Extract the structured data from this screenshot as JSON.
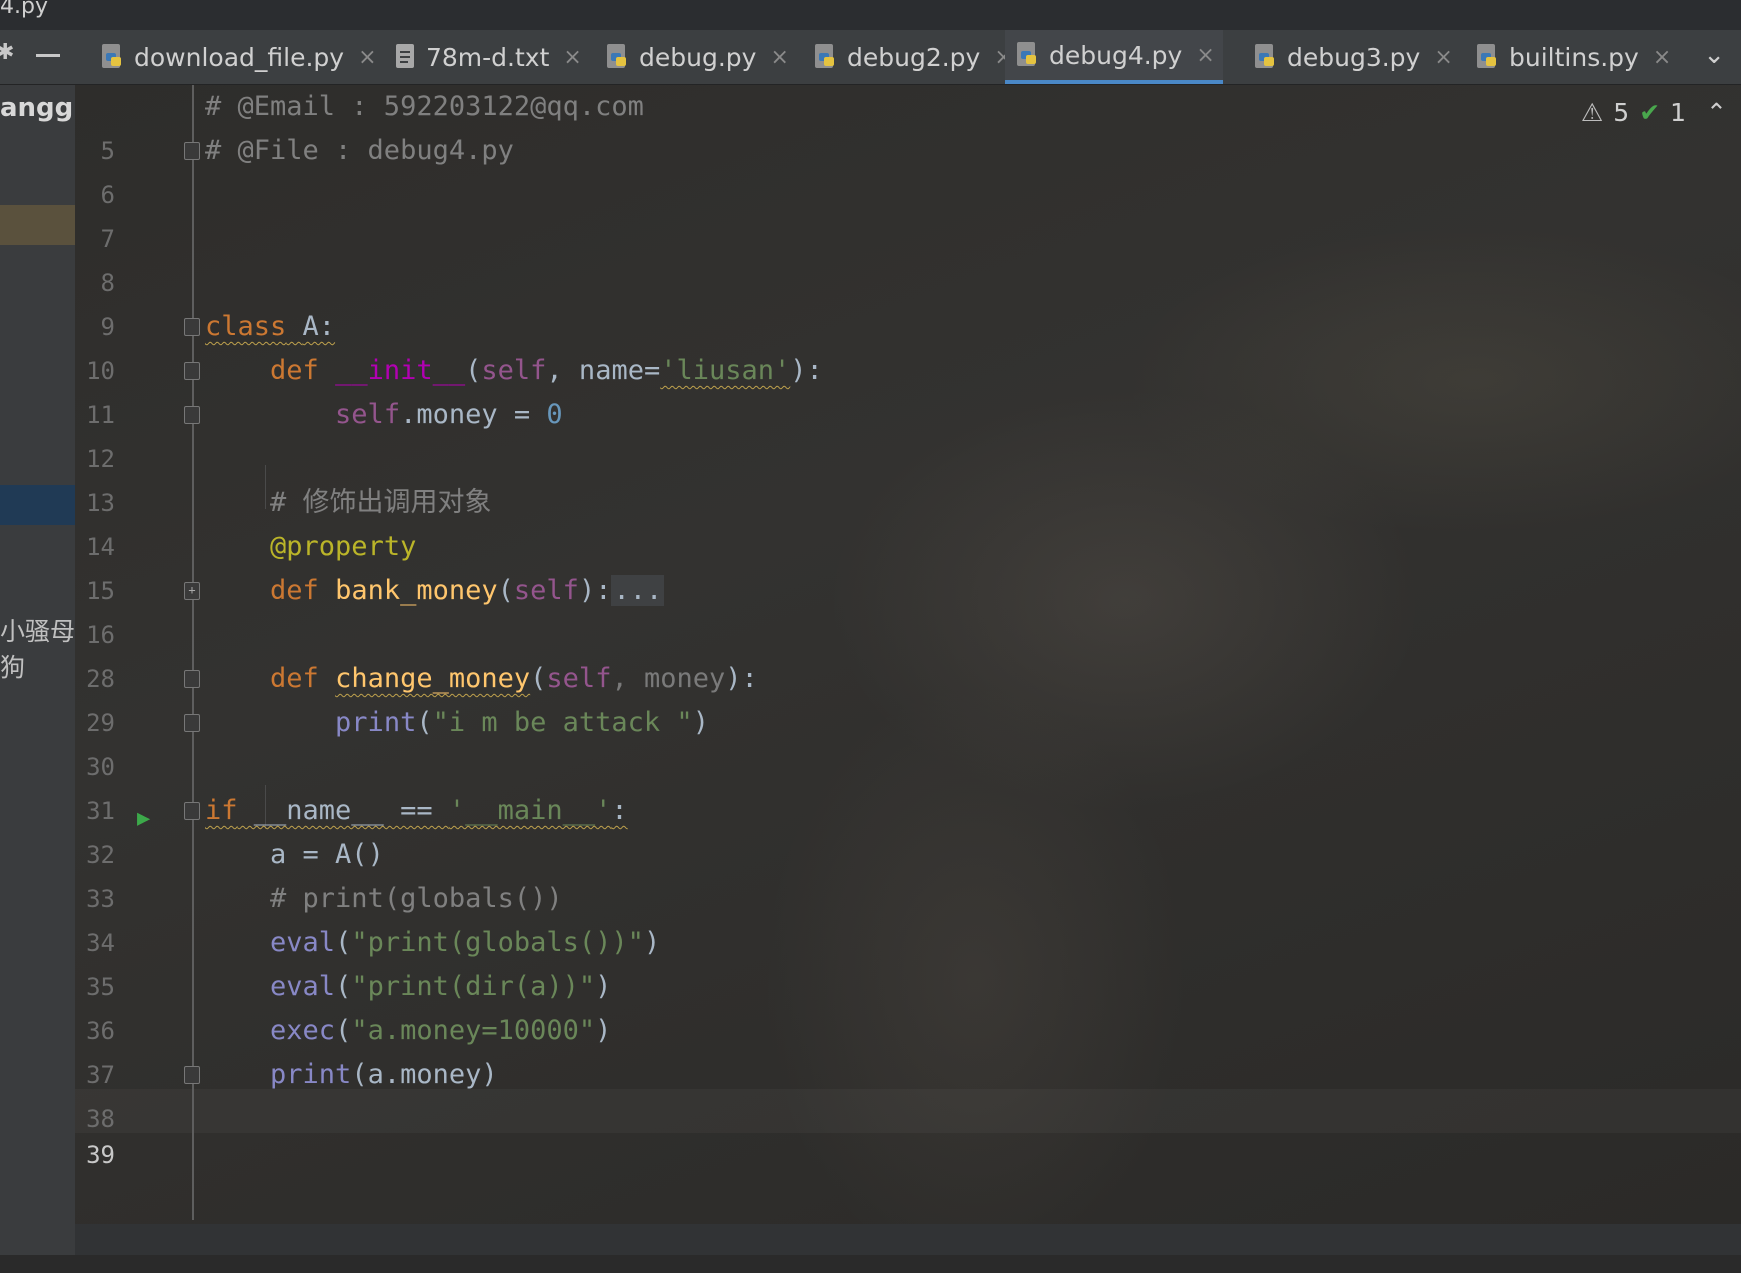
{
  "window": {
    "title_fragment": "4.py"
  },
  "tabs": [
    {
      "label": "download_file.py",
      "icon": "python-file-icon",
      "active": false
    },
    {
      "label": "78m-d.txt",
      "icon": "text-file-icon",
      "active": false
    },
    {
      "label": "debug.py",
      "icon": "python-file-icon",
      "active": false
    },
    {
      "label": "debug2.py",
      "icon": "python-file-icon",
      "active": false
    },
    {
      "label": "debug4.py",
      "icon": "python-file-icon",
      "active": true
    },
    {
      "label": "debug3.py",
      "icon": "python-file-icon",
      "active": false
    },
    {
      "label": "builtins.py",
      "icon": "python-file-icon",
      "active": false
    }
  ],
  "tab_close_glyph": "×",
  "sidebar": {
    "top_text": "anggu",
    "lower_text": "小骚母狗"
  },
  "inspections": {
    "warnings": "5",
    "weak_warnings": "1"
  },
  "line_numbers": [
    "5",
    "6",
    "7",
    "8",
    "9",
    "10",
    "11",
    "12",
    "13",
    "14",
    "15",
    "16",
    "28",
    "29",
    "30",
    "31",
    "32",
    "33",
    "34",
    "35",
    "36",
    "37",
    "38",
    "39"
  ],
  "code": {
    "l5": "# @Email : 592203122@qq.com",
    "l6": "# @File : debug4.py",
    "l10_kw": "class",
    "l10_name": "A:",
    "l11_def": "def",
    "l11_fn": "__init__",
    "l11_open": "(",
    "l11_self": "self",
    "l11_mid": ", name=",
    "l11_str": "'liusan'",
    "l11_close": "):",
    "l12_self": "self",
    "l12_rest": ".money = ",
    "l12_num": "0",
    "l14": "# 修饰出调用对象",
    "l15": "@property",
    "l16_def": "def",
    "l16_fn": "bank_money",
    "l16_open": "(",
    "l16_self": "self",
    "l16_close": "):",
    "l16_dots": "...",
    "l29_def": "def",
    "l29_fn": "change_money",
    "l29_open": "(",
    "l29_self": "self",
    "l29_mid": ", money",
    "l29_close": "):",
    "l30_fn": "print",
    "l30_open": "(",
    "l30_str": "\"i m be attack \"",
    "l30_close": ")",
    "l32_kw": "if",
    "l32_name": " __name__ == ",
    "l32_str": "'__main__'",
    "l32_colon": ":",
    "l33": "a = A()",
    "l34": "# print(globals())",
    "l35_fn": "eval",
    "l35_open": "(",
    "l35_str": "\"print(globals())\"",
    "l35_close": ")",
    "l36_fn": "eval",
    "l36_open": "(",
    "l36_str": "\"print(dir(a))\"",
    "l36_close": ")",
    "l37_fn": "exec",
    "l37_open": "(",
    "l37_str": "\"a.money=10000\"",
    "l37_close": ")",
    "l38_fn": "print",
    "l38_rest": "(a.money)"
  },
  "colors": {
    "keyword": "#cc7832",
    "function": "#ffc66d",
    "string": "#6a8759",
    "comment": "#808080",
    "number": "#6897bb",
    "self": "#94558d",
    "magic": "#b200b2",
    "decorator": "#bbb529",
    "builtin": "#8888c6",
    "active_tab_underline": "#4a88c7"
  }
}
